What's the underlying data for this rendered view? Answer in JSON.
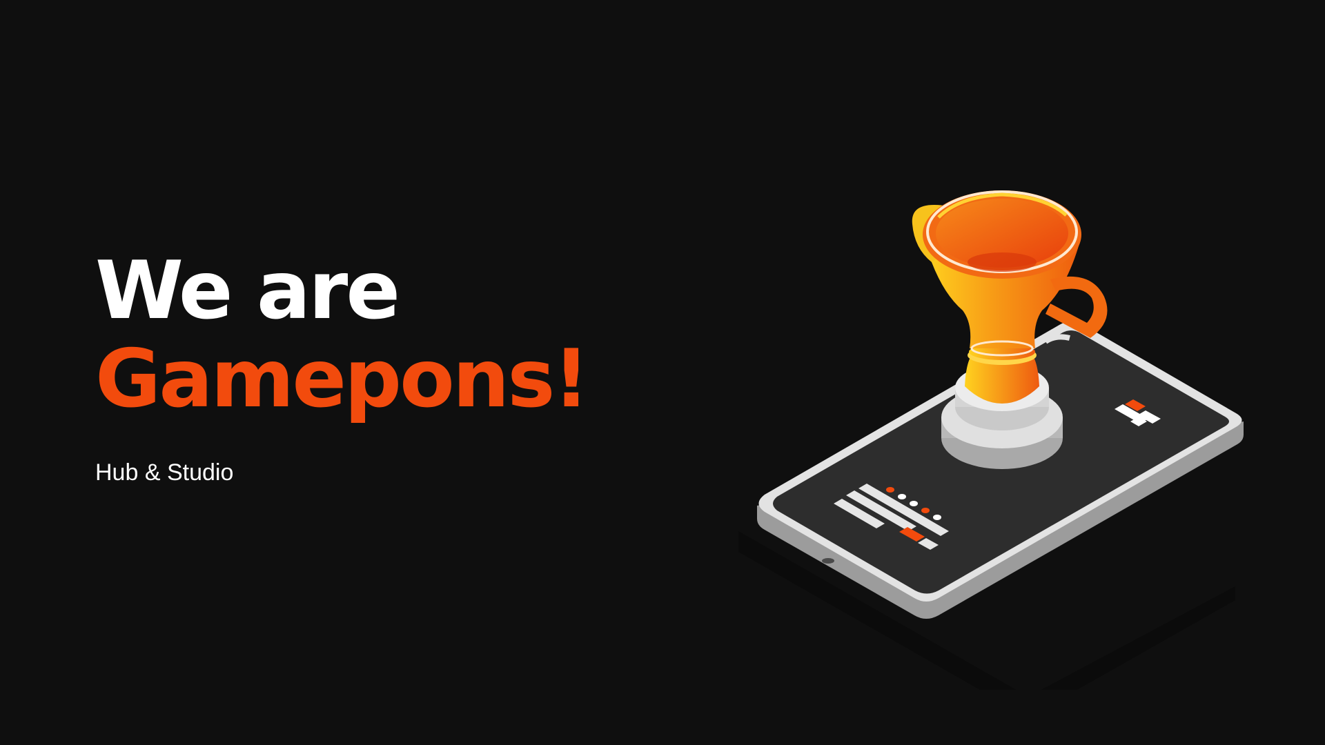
{
  "hero": {
    "line1": "We are",
    "line2": "Gamepons!",
    "tagline": "Hub & Studio"
  },
  "colors": {
    "background": "#0f0f0f",
    "accent": "#f24b0d",
    "text": "#ffffff",
    "trophy_gold": "#f7a81c",
    "phone_screen": "#2d2d2d",
    "phone_frame": "#d9d9d9"
  },
  "illustration": {
    "subject": "trophy-on-smartphone-icon"
  }
}
